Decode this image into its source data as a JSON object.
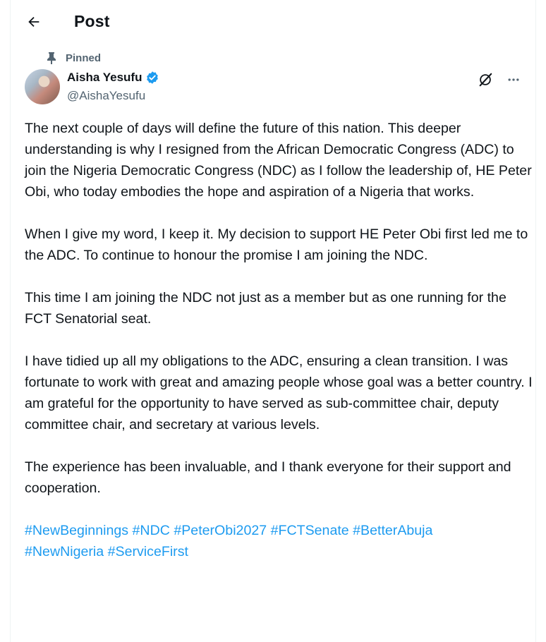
{
  "header": {
    "title": "Post"
  },
  "pinned_label": "Pinned",
  "author": {
    "name": "Aisha Yesufu",
    "handle": "@AishaYesufu"
  },
  "paragraphs": [
    "The next couple of days will define the future of this nation. This deeper understanding is why I resigned from the African Democratic Congress (ADC) to join the Nigeria Democratic Congress (NDC) as I follow the leadership of, HE Peter Obi, who today embodies the hope and aspiration of a Nigeria that works.",
    "When I give my word, I keep it. My decision to support HE Peter Obi first led me to the ADC. To continue to honour the promise I am joining the NDC.",
    "This time I am joining the NDC not just as a member but as one running for the FCT Senatorial seat.",
    "I have tidied up all my obligations to the ADC, ensuring a clean transition. I was fortunate to work with great and amazing people whose goal was a better country. I am grateful for the opportunity to have served as sub-committee chair, deputy committee chair, and secretary at various levels.",
    "The experience has been invaluable, and I thank everyone for their support and cooperation."
  ],
  "hashtags": [
    "#NewBeginnings",
    "#NDC",
    "#PeterObi2027",
    "#FCTSenate",
    "#BetterAbuja",
    "#NewNigeria",
    "#ServiceFirst"
  ],
  "colors": {
    "accent": "#1d9bf0",
    "secondary_text": "#536471",
    "primary_text": "#0f1419",
    "verified": "#1d9bf0"
  },
  "icons": {
    "back": "arrow-left-icon",
    "pin": "pin-icon",
    "verified": "verified-badge-icon",
    "grok": "grok-icon",
    "more": "more-horizontal-icon"
  }
}
